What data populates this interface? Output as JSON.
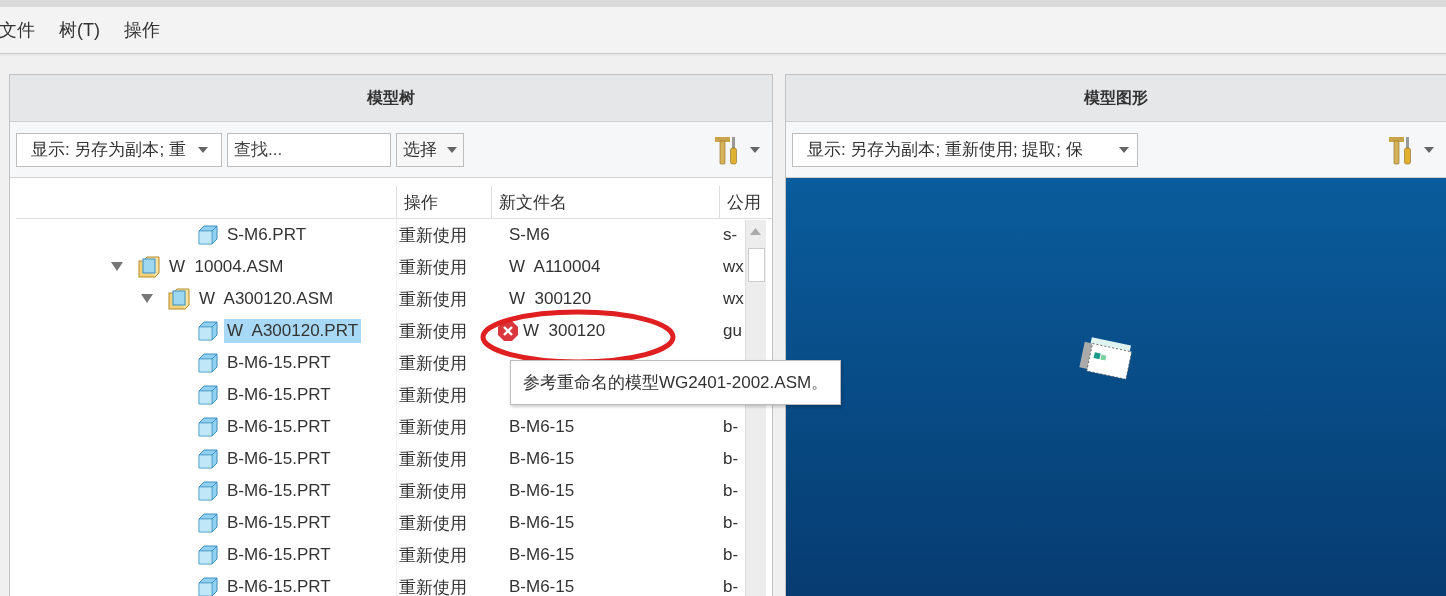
{
  "menu": [
    {
      "label": "文件"
    },
    {
      "label": "树(T)"
    },
    {
      "label": "操作"
    }
  ],
  "tree_panel": {
    "title": "模型树",
    "display_dropdown": "显示: 另存为副本; 重",
    "search": {
      "placeholder": "查找..."
    },
    "select_button": "选择",
    "columns": [
      "操作",
      "新文件名",
      "公用"
    ],
    "items": [
      {
        "children": [
          {
            "children": [
              {
                "name": "S-M6.PRT",
                "kind": "part",
                "action": "重新使用",
                "new_name": "S-M6",
                "column_4": "s-",
                "selected": false,
                "error": false
              }
            ]
          }
        ]
      },
      {
        "name": "W  10004.ASM",
        "kind": "assembly",
        "expanded": true,
        "action": "重新使用",
        "new_name": "W  A110004",
        "column_4": "wx",
        "selected": false,
        "error": false,
        "children": [
          {
            "name": "W  A300120.ASM",
            "kind": "assembly",
            "expanded": true,
            "action": "重新使用",
            "new_name": "W  300120",
            "column_4": "wx",
            "selected": false,
            "error": false,
            "children": [
              {
                "name": "W  A300120.PRT",
                "kind": "part",
                "action": "重新使用",
                "new_name": "W  300120",
                "column_4": "gu",
                "selected": true,
                "error": true
              },
              {
                "name": "B-M6-15.PRT",
                "kind": "part",
                "action": "重新使用",
                "selected": false,
                "error": false
              },
              {
                "name": "B-M6-15.PRT",
                "kind": "part",
                "action": "重新使用",
                "selected": false,
                "error": false
              },
              {
                "name": "B-M6-15.PRT",
                "kind": "part",
                "action": "重新使用",
                "new_name": "B-M6-15",
                "column_4": "b-",
                "selected": false,
                "error": false
              },
              {
                "name": "B-M6-15.PRT",
                "kind": "part",
                "action": "重新使用",
                "new_name": "B-M6-15",
                "column_4": "b-",
                "selected": false,
                "error": false
              },
              {
                "name": "B-M6-15.PRT",
                "kind": "part",
                "action": "重新使用",
                "new_name": "B-M6-15",
                "column_4": "b-",
                "selected": false,
                "error": false
              },
              {
                "name": "B-M6-15.PRT",
                "kind": "part",
                "action": "重新使用",
                "new_name": "B-M6-15",
                "column_4": "b-",
                "selected": false,
                "error": false
              },
              {
                "name": "B-M6-15.PRT",
                "kind": "part",
                "action": "重新使用",
                "new_name": "B-M6-15",
                "column_4": "b-",
                "selected": false,
                "error": false
              },
              {
                "name": "B-M6-15.PRT",
                "kind": "part",
                "action": "重新使用",
                "new_name": "B-M6-15",
                "column_4": "b-",
                "selected": false,
                "error": false
              }
            ]
          }
        ]
      }
    ],
    "tooltip": "参考重命名的模型WG2401-2002.ASM。"
  },
  "graphics_panel": {
    "title": "模型图形",
    "display_dropdown": "显示: 另存为副本; 重新使用; 提取; 保"
  }
}
